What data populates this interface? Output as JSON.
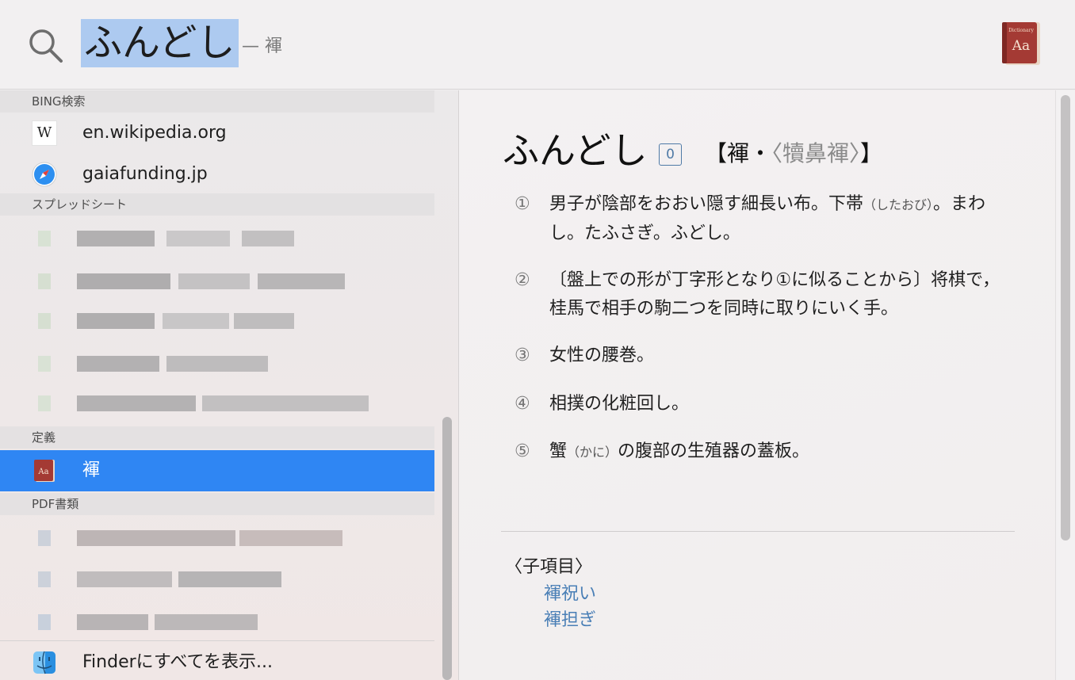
{
  "search": {
    "query": "ふんどし",
    "suffix": "— 褌"
  },
  "icons": {
    "search": "search-icon",
    "dictionary": "dictionary-icon",
    "wikipedia": "wikipedia-icon",
    "safari": "safari-icon",
    "finder": "finder-icon"
  },
  "results": {
    "sections": [
      {
        "header": "BING検索",
        "items": [
          {
            "label": "en.wikipedia.org",
            "icon": "wikipedia-icon"
          },
          {
            "label": "gaiafunding.jp",
            "icon": "safari-icon"
          }
        ]
      },
      {
        "header": "スプレッドシート",
        "items": []
      },
      {
        "header": "定義",
        "items": [
          {
            "label": "褌",
            "icon": "dictionary-icon",
            "selected": true
          }
        ]
      },
      {
        "header": "PDF書類",
        "items": []
      }
    ],
    "footer": "Finderにすべてを表示..."
  },
  "preview": {
    "headword": "ふんどし",
    "badge": "0",
    "notation_open": "【褌・",
    "notation_alt": "〈犢鼻褌〉",
    "notation_close": "】",
    "senses": [
      {
        "num": "①",
        "before": "男子が陰部をおおい隠す細長い布。下帯",
        "ruby": "（したおび）",
        "after": "。まわし。たふさぎ。ふどし。"
      },
      {
        "num": "②",
        "before": "〔盤上での形が丁字形となり①に似ることから〕将棋で，桂馬で相手の駒二つを同時に取りにいく手。",
        "ruby": "",
        "after": ""
      },
      {
        "num": "③",
        "before": "女性の腰巻。",
        "ruby": "",
        "after": ""
      },
      {
        "num": "④",
        "before": "相撲の化粧回し。",
        "ruby": "",
        "after": ""
      },
      {
        "num": "⑤",
        "before": "蟹",
        "ruby": "（かに）",
        "after": "の腹部の生殖器の蓋板。"
      }
    ],
    "subitems_header": "〈子項目〉",
    "subitems": [
      "褌祝い",
      "褌担ぎ"
    ]
  },
  "colors": {
    "selection": "#2f86f3",
    "query_highlight": "#adcaf0",
    "link": "#4a7fb6"
  }
}
